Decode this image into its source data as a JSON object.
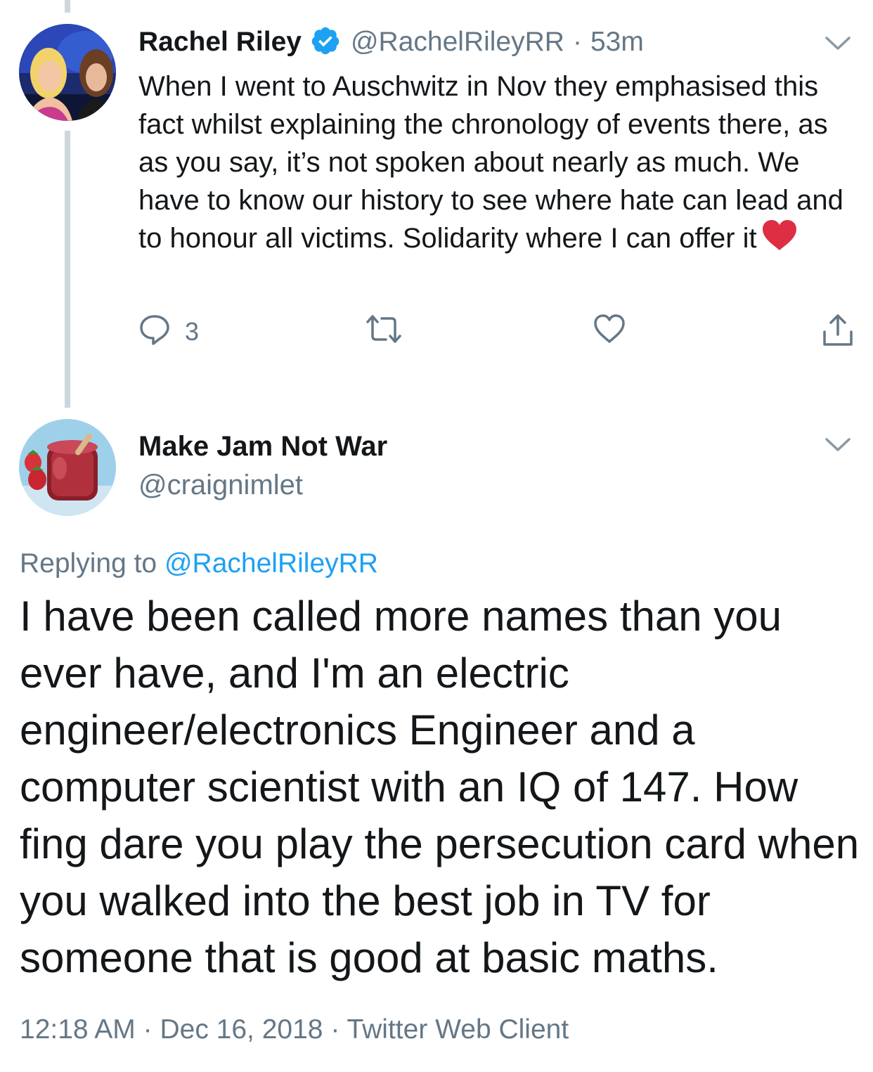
{
  "tweet1": {
    "display_name": "Rachel Riley",
    "handle": "@RachelRileyRR",
    "separator": "·",
    "time_ago": "53m",
    "text": "When I went to Auschwitz in Nov they emphasised this fact whilst explaining the chronology of events there, as as you say, it’s not spoken about nearly as much. We have to know our history to see where hate can lead and to honour all victims. Solidarity where I can offer it",
    "reply_count": "3"
  },
  "tweet2": {
    "display_name": "Make Jam Not War",
    "handle": "@craignimlet",
    "replying_prefix": "Replying to",
    "replying_mention": "@RachelRileyRR",
    "text": "I have been called more names than you ever have, and I'm an electric engineer/electronics Engineer and a computer scientist with an IQ of 147. How fing dare you play the persecution card when you walked into the best job in TV for someone that is good at basic maths.",
    "timestamp": "12:18 AM",
    "date": "Dec 16, 2018",
    "client": "Twitter Web Client",
    "meta_separator": "·"
  },
  "colors": {
    "text": "#14171a",
    "secondary": "#657786",
    "accent": "#1da1f2",
    "thread_line": "#ccd6dd",
    "heart_emoji": "#dd2e44"
  },
  "icons": [
    "verified-badge-icon",
    "chevron-down-icon",
    "reply-icon",
    "retweet-icon",
    "like-icon",
    "share-icon",
    "red-heart-emoji"
  ]
}
